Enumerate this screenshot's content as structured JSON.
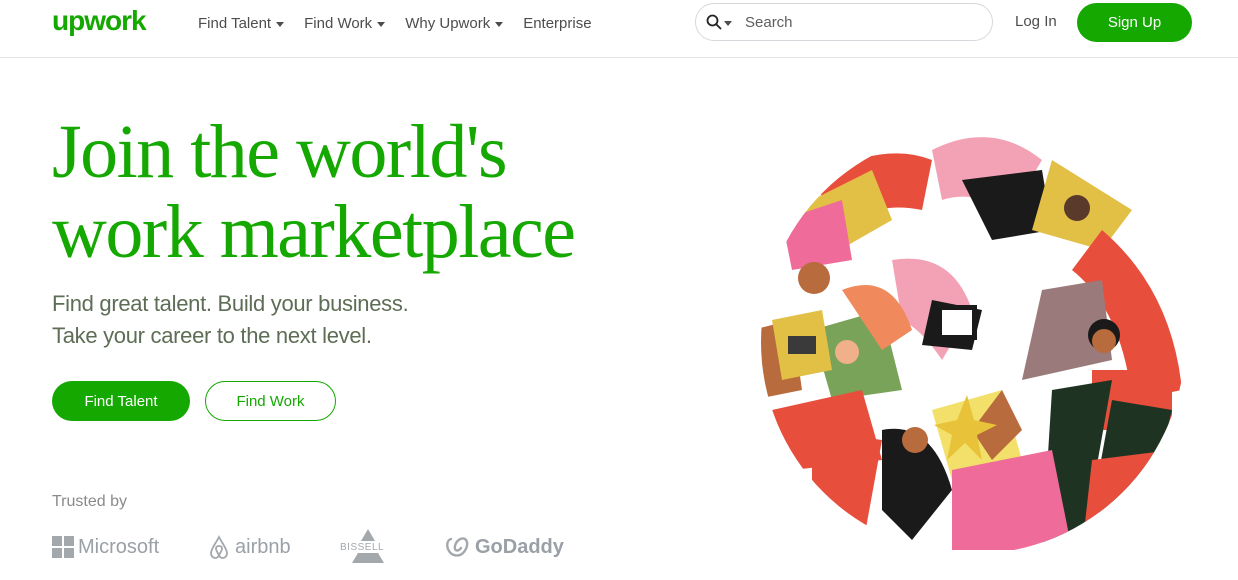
{
  "brand": {
    "logo_text": "upwork",
    "accent": "#14a800"
  },
  "nav": {
    "items": [
      {
        "label": "Find Talent",
        "has_dropdown": true
      },
      {
        "label": "Find Work",
        "has_dropdown": true
      },
      {
        "label": "Why Upwork",
        "has_dropdown": true
      },
      {
        "label": "Enterprise",
        "has_dropdown": false
      }
    ]
  },
  "search": {
    "placeholder": "Search",
    "icon": "search-icon"
  },
  "auth": {
    "login_label": "Log In",
    "signup_label": "Sign Up"
  },
  "hero": {
    "title_line1": "Join the world's",
    "title_line2": "work marketplace",
    "subtitle_line1": "Find great talent. Build your business.",
    "subtitle_line2": "Take your career to the next level.",
    "primary_cta": "Find Talent",
    "secondary_cta": "Find Work"
  },
  "trusted": {
    "label": "Trusted by",
    "brands": [
      "Microsoft",
      "airbnb",
      "BISSELL",
      "GoDaddy"
    ]
  }
}
